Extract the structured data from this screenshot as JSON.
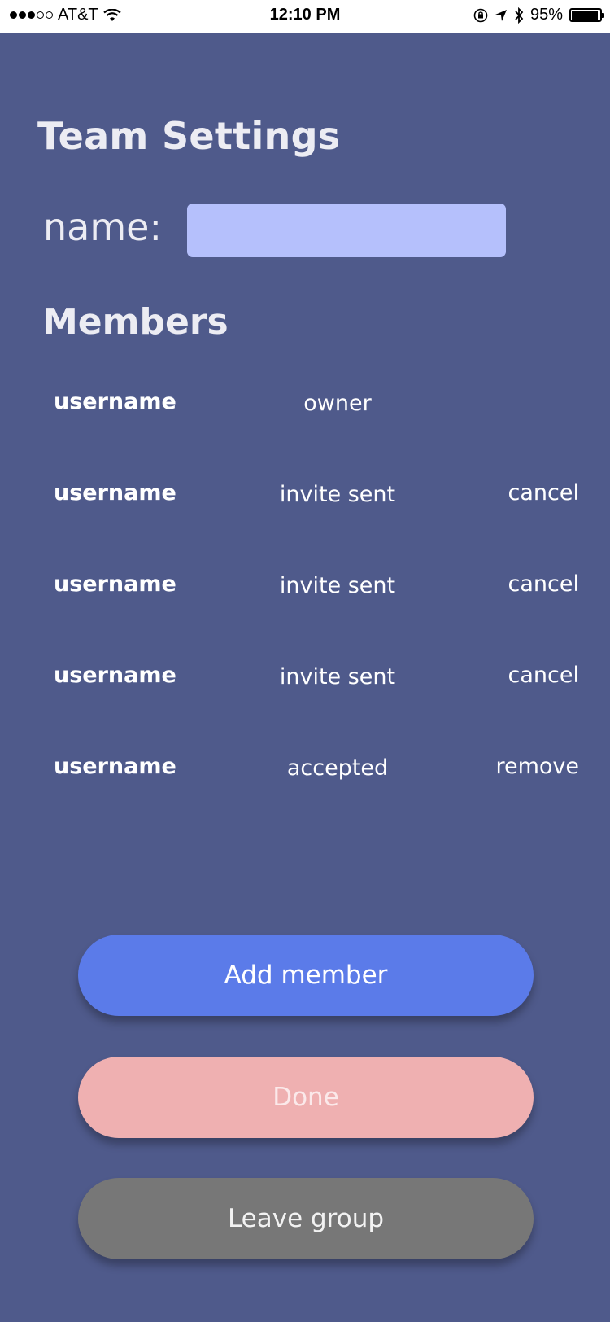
{
  "status_bar": {
    "carrier": "AT&T",
    "time": "12:10 PM",
    "battery": "95%",
    "signal_bars_filled": 3,
    "signal_bars_total": 5,
    "battery_level": 0.95
  },
  "page": {
    "title": "Team Settings",
    "name_label": "name:",
    "name_value": "",
    "members_heading": "Members"
  },
  "members": [
    {
      "username": "username",
      "status": "owner",
      "action": ""
    },
    {
      "username": "username",
      "status": "invite sent",
      "action": "cancel"
    },
    {
      "username": "username",
      "status": "invite sent",
      "action": "cancel"
    },
    {
      "username": "username",
      "status": "invite sent",
      "action": "cancel"
    },
    {
      "username": "username",
      "status": "accepted",
      "action": "remove"
    }
  ],
  "buttons": {
    "add_member": "Add member",
    "done": "Done",
    "leave_group": "Leave group"
  },
  "colors": {
    "background": "#4f5a8b",
    "input_background": "#b5c0fc",
    "add_button": "#5b7be9",
    "done_button": "#efb0b1",
    "leave_button": "#777777"
  }
}
